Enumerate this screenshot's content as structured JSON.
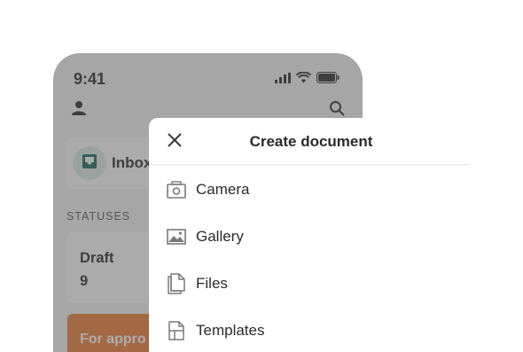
{
  "status_bar": {
    "time": "9:41"
  },
  "background": {
    "inbox_label": "Inbox",
    "statuses_heading": "STATUSES",
    "draft": {
      "name": "Draft",
      "count": "9"
    },
    "approval_label": "For appro"
  },
  "sheet": {
    "title": "Create document",
    "items": [
      {
        "label": "Camera",
        "icon": "camera-icon"
      },
      {
        "label": "Gallery",
        "icon": "image-icon"
      },
      {
        "label": "Files",
        "icon": "files-icon"
      },
      {
        "label": "Templates",
        "icon": "template-icon"
      }
    ]
  },
  "colors": {
    "accent_orange": "#f0813a",
    "inbox_green": "#1f6b5c",
    "dim_overlay": "rgba(80,80,80,0.48)"
  }
}
